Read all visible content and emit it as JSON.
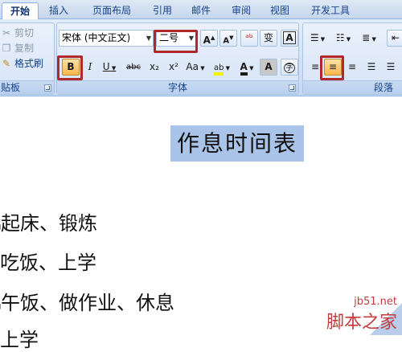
{
  "tabs": [
    {
      "label": "开始",
      "active": true
    },
    {
      "label": "插入"
    },
    {
      "label": "页面布局"
    },
    {
      "label": "引用"
    },
    {
      "label": "邮件"
    },
    {
      "label": "审阅"
    },
    {
      "label": "视图"
    },
    {
      "label": "开发工具"
    }
  ],
  "clipboard": {
    "cut_label": "剪切",
    "copy_label": "复制",
    "format_painter_label": "格式刷",
    "group_label": "贴板"
  },
  "font": {
    "font_name": "宋体 (中文正文)",
    "font_size": "二号",
    "group_label": "字体",
    "grow_font": "A",
    "shrink_font": "A",
    "bold": "B",
    "italic": "I",
    "underline": "U",
    "strikethrough": "abc",
    "subscript": "x₂",
    "superscript": "x²",
    "change_case": "Aa",
    "font_color": "A",
    "char_shading": "A",
    "enclose_char": "字"
  },
  "paragraph": {
    "group_label": "段落"
  },
  "document": {
    "title": "作息时间表",
    "lines": [
      "起床、锻炼",
      "吃饭、上学",
      "午饭、做作业、休息",
      "上学"
    ]
  },
  "watermark": {
    "site": "jb51.net",
    "name": "脚本之家"
  },
  "colors": {
    "highlight_box": "#b0272c",
    "selection": "#a9c4e8",
    "ribbon_bg": "#dbe7f7"
  }
}
